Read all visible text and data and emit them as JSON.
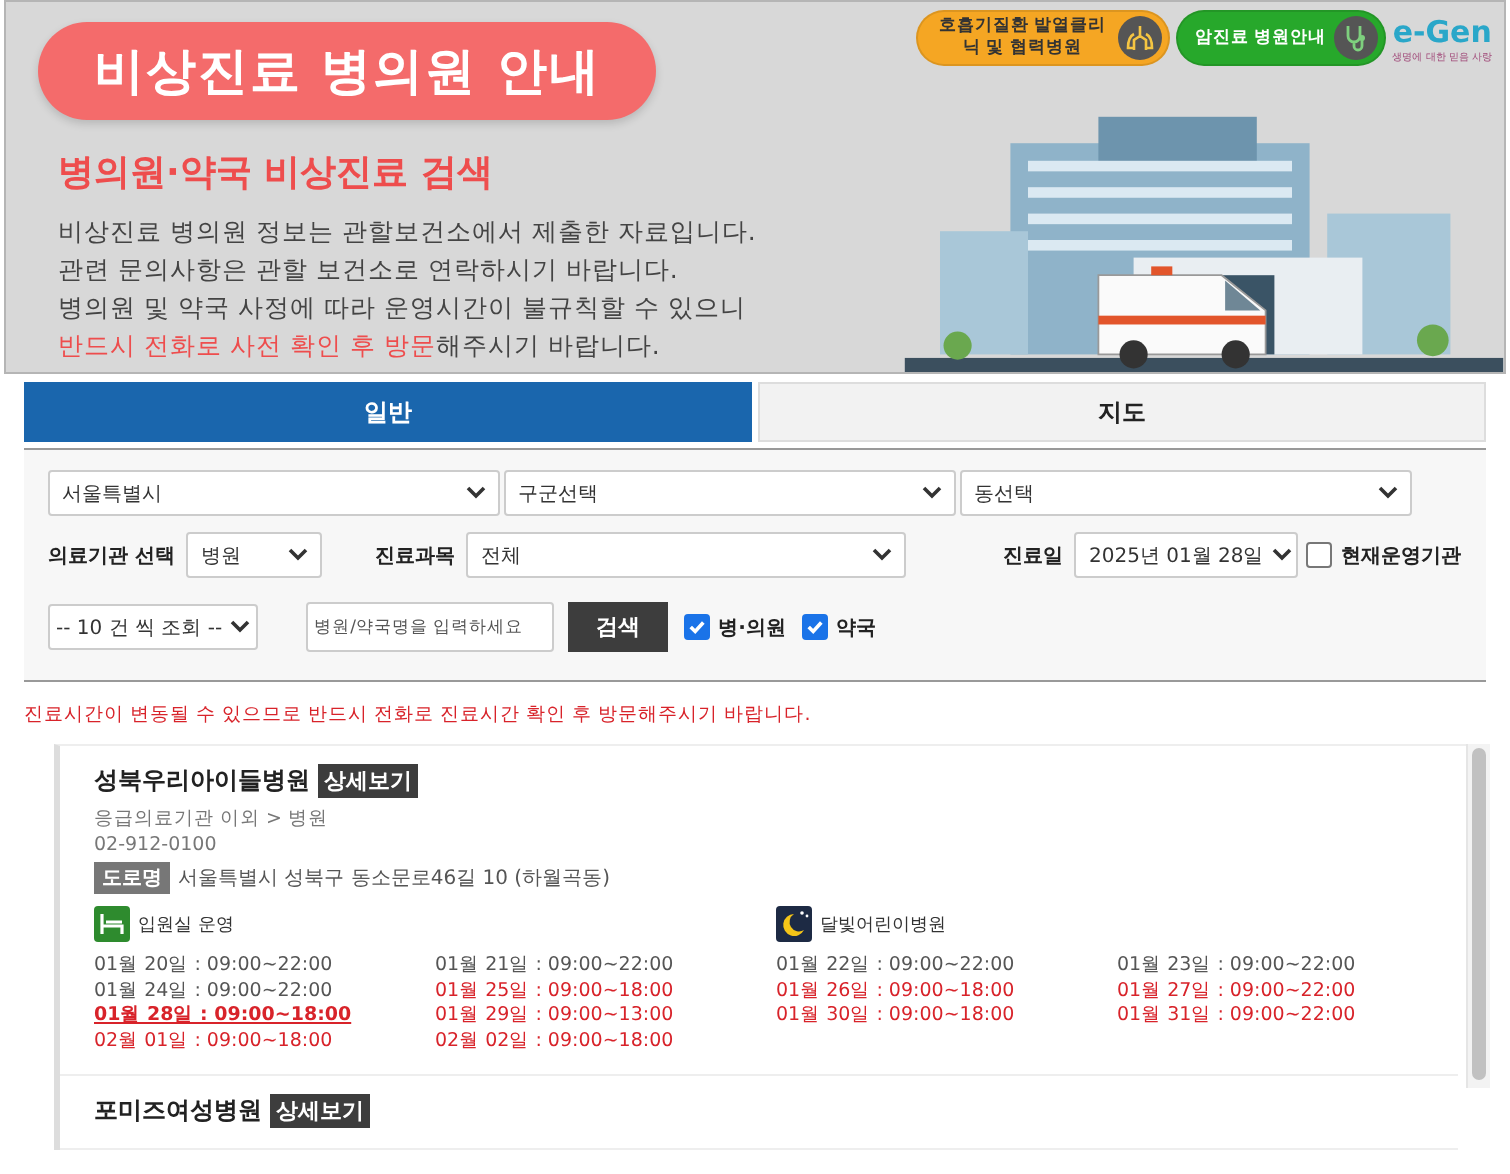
{
  "banner": {
    "title": "비상진료 병의원 안내",
    "subtitle": "병의원·약국 비상진료 검색",
    "lines": [
      "비상진료 병의원 정보는 관할보건소에서 제출한 자료입니다.",
      "관련 문의사항은 관할 보건소로 연락하시기 바랍니다.",
      "병의원 및 약국 사정에 따라 운영시간이 불규칙할 수 있으니",
      "**반드시 전화로 사전 확인 후 방문**해주시기 바랍니다."
    ],
    "links": [
      {
        "kind": "fever",
        "label": "호흡기질환 발열클리닉 및 협력병원"
      },
      {
        "kind": "cancer",
        "label": "암진료 병원안내"
      }
    ],
    "logo": {
      "text": "e-Gen",
      "tagline": "생명에 대한 믿음 사랑"
    }
  },
  "tabs": [
    {
      "label": "일반",
      "selected": true
    },
    {
      "label": "지도",
      "selected": false
    }
  ],
  "filters": {
    "region": [
      "서울특별시",
      "구군선택",
      "동선택"
    ],
    "fields": [
      {
        "label": "의료기관 선택",
        "value": "병원"
      },
      {
        "label": "진료과목",
        "value": "전체"
      },
      {
        "label": "진료일",
        "value": "2025년 01월 28일"
      }
    ],
    "current_only": {
      "label": "현재운영기관",
      "checked": false
    },
    "page_size": "-- 10 건 씩 조회 --",
    "search": {
      "placeholder": "병원/약국명을 입력하세요",
      "button": "검색"
    },
    "types": [
      {
        "label": "병·의원",
        "checked": true
      },
      {
        "label": "약국",
        "checked": true
      }
    ]
  },
  "notice": "진료시간이 변동될 수 있으므로 반드시 전화로 진료시간 확인 후 방문해주시기 바랍니다.",
  "results": [
    {
      "name": "성북우리아이들병원",
      "detail": "상세보기",
      "category": "응급의료기관 이외 > 병원",
      "phone": "02-912-0100",
      "address_tag": "도로명",
      "address": "서울특별시 성북구 동소문로46길 10 (하월곡동)",
      "badges": [
        {
          "kind": "bed",
          "label": "입원실 운영"
        },
        {
          "kind": "moon",
          "label": "달빛어린이병원"
        }
      ],
      "schedule": [
        {
          "text": "01월 20일 : 09:00~22:00",
          "holiday": false,
          "selected": false
        },
        {
          "text": "01월 21일 : 09:00~22:00",
          "holiday": false,
          "selected": false
        },
        {
          "text": "01월 22일 : 09:00~22:00",
          "holiday": false,
          "selected": false
        },
        {
          "text": "01월 23일 : 09:00~22:00",
          "holiday": false,
          "selected": false
        },
        {
          "text": "01월 24일 : 09:00~22:00",
          "holiday": false,
          "selected": false
        },
        {
          "text": "01월 25일 : 09:00~18:00",
          "holiday": true,
          "selected": false
        },
        {
          "text": "01월 26일 : 09:00~18:00",
          "holiday": true,
          "selected": false
        },
        {
          "text": "01월 27일 : 09:00~22:00",
          "holiday": true,
          "selected": false
        },
        {
          "text": "01월 28일 : 09:00~18:00",
          "holiday": true,
          "selected": true
        },
        {
          "text": "01월 29일 : 09:00~13:00",
          "holiday": true,
          "selected": false
        },
        {
          "text": "01월 30일 : 09:00~18:00",
          "holiday": true,
          "selected": false
        },
        {
          "text": "01월 31일 : 09:00~22:00",
          "holiday": true,
          "selected": false
        },
        {
          "text": "02월 01일 : 09:00~18:00",
          "holiday": true,
          "selected": false
        },
        {
          "text": "02월 02일 : 09:00~18:00",
          "holiday": true,
          "selected": false
        }
      ]
    },
    {
      "name": "포미즈여성병원",
      "detail": "상세보기"
    }
  ]
}
